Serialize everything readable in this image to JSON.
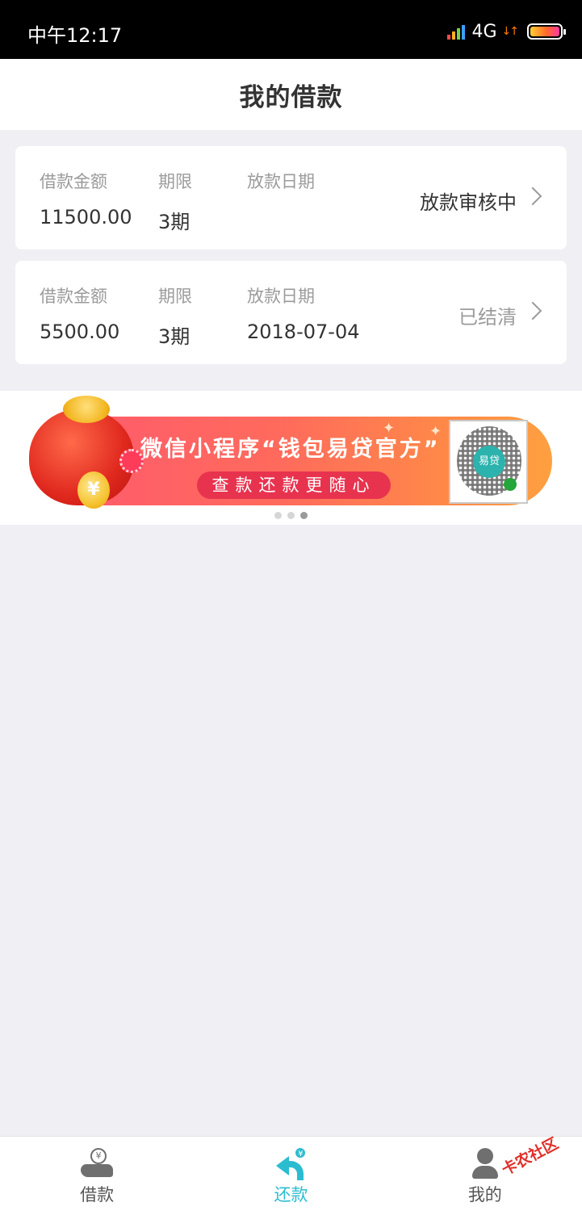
{
  "status_bar": {
    "time": "中午12:17",
    "network": "4G",
    "signal_icon": "signal-bars-icon",
    "battery_icon": "battery-icon"
  },
  "header": {
    "title": "我的借款"
  },
  "loans": [
    {
      "amount_label": "借款金额",
      "amount": "11500.00",
      "term_label": "期限",
      "term": "3期",
      "date_label": "放款日期",
      "date": "",
      "status": "放款审核中"
    },
    {
      "amount_label": "借款金额",
      "amount": "5500.00",
      "term_label": "期限",
      "term": "3期",
      "date_label": "放款日期",
      "date": "2018-07-04",
      "status": "已结清"
    }
  ],
  "banner": {
    "line1": "微信小程序“钱包易贷官方”",
    "line2": "查款还款更随心",
    "qr_logo_text": "易贷",
    "carousel_active_index": 2,
    "carousel_count": 3
  },
  "tab_bar": {
    "tabs": [
      {
        "label": "借款",
        "icon": "borrow-icon",
        "active": false
      },
      {
        "label": "还款",
        "icon": "repay-icon",
        "active": true
      },
      {
        "label": "我的",
        "icon": "user-icon",
        "active": false
      }
    ]
  },
  "watermark": "卡农社区",
  "colors": {
    "accent": "#2bbcd0",
    "background": "#efeff4",
    "banner_start": "#ff5a6e",
    "banner_end": "#ffa040"
  }
}
